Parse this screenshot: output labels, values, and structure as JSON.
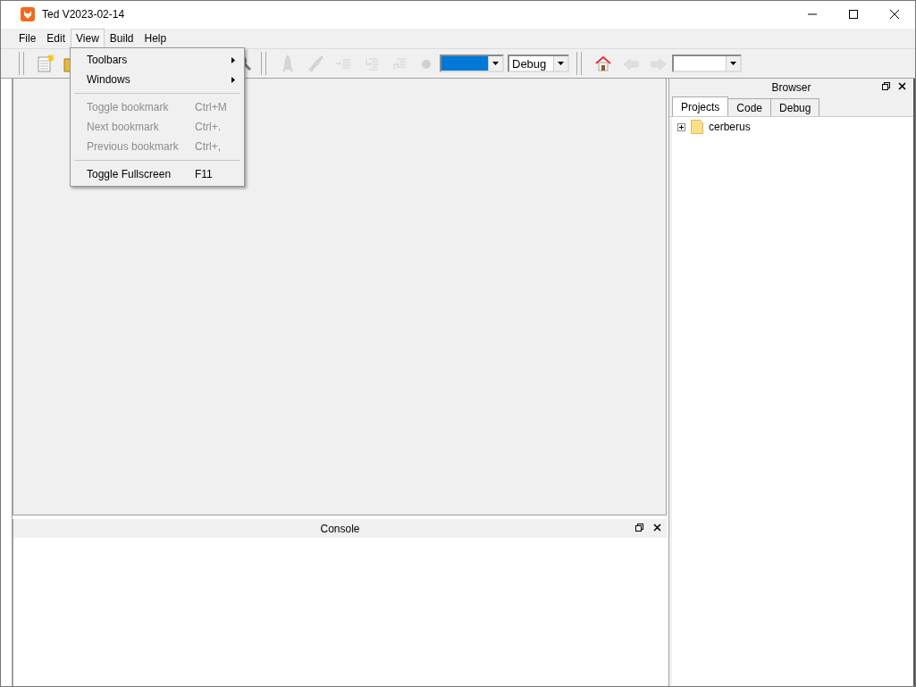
{
  "window": {
    "title": "Ted V2023-02-14"
  },
  "menu_bar": [
    {
      "label": "File",
      "selected": false
    },
    {
      "label": "Edit",
      "selected": false
    },
    {
      "label": "View",
      "selected": true
    },
    {
      "label": "Build",
      "selected": false
    },
    {
      "label": "Help",
      "selected": false
    }
  ],
  "view_menu": [
    {
      "kind": "submenu",
      "label": "Toolbars",
      "disabled": false
    },
    {
      "kind": "submenu",
      "label": "Windows",
      "disabled": false
    },
    {
      "kind": "separator"
    },
    {
      "kind": "item",
      "label": "Toggle bookmark",
      "shortcut": "Ctrl+M",
      "disabled": true
    },
    {
      "kind": "item",
      "label": "Next bookmark",
      "shortcut": "Ctrl+.",
      "disabled": true
    },
    {
      "kind": "item",
      "label": "Previous bookmark",
      "shortcut": "Ctrl+,",
      "disabled": true
    },
    {
      "kind": "separator"
    },
    {
      "kind": "item",
      "label": "Toggle Fullscreen",
      "shortcut": "F11",
      "disabled": false
    }
  ],
  "toolbar": {
    "buttons": [
      {
        "disabled": false
      },
      {
        "disabled": false
      },
      {
        "disabled": false
      },
      {
        "disabled": true
      },
      {
        "disabled": true
      },
      {
        "disabled": true
      },
      {
        "disabled": true
      },
      {
        "disabled": true
      },
      {
        "disabled": true
      },
      {
        "disabled": false
      },
      {
        "disabled": true
      },
      {
        "disabled": true
      }
    ],
    "combos": [
      {
        "focused": true
      },
      {
        "value": "Debug",
        "focused": false
      },
      {
        "focused": false
      }
    ]
  },
  "browser": {
    "title": "Browser",
    "tabs": [
      {
        "label": "Projects",
        "selected": true
      },
      {
        "label": "Code",
        "selected": false
      },
      {
        "label": "Debug",
        "selected": false
      }
    ],
    "tree": [
      {
        "label": "cerberus",
        "expanded": false
      }
    ]
  },
  "console": {
    "title": "Console"
  }
}
